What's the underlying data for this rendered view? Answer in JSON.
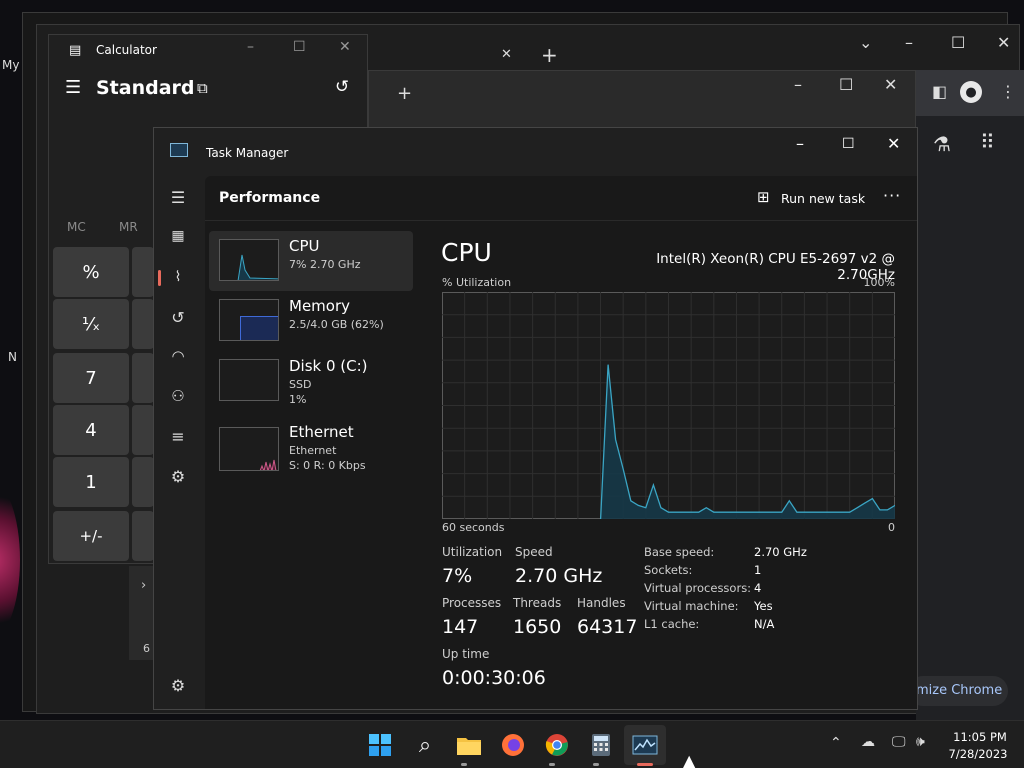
{
  "desktop": {
    "label_my": "My",
    "label_n": "N"
  },
  "chrome": {
    "customize_label": "mize Chrome",
    "new_tab_symbol": "+",
    "close_tab_symbol": "✕",
    "calc_partial_text": "6"
  },
  "calculator": {
    "title": "Calculator",
    "mode": "Standard",
    "memory": [
      "MC",
      "MR"
    ],
    "buttons": [
      "%",
      "¹⁄ₓ",
      "7",
      "4",
      "1",
      "+/-"
    ]
  },
  "taskmanager": {
    "title": "Task Manager",
    "section": "Performance",
    "run_new_task": "Run new task",
    "more": "···",
    "resources": [
      {
        "name": "CPU",
        "sub1": "7% 2.70 GHz",
        "sub2": ""
      },
      {
        "name": "Memory",
        "sub1": "2.5/4.0 GB (62%)",
        "sub2": ""
      },
      {
        "name": "Disk 0 (C:)",
        "sub1": "SSD",
        "sub2": "1%"
      },
      {
        "name": "Ethernet",
        "sub1": "Ethernet",
        "sub2": "S: 0 R: 0 Kbps"
      }
    ],
    "cpu": {
      "heading": "CPU",
      "model": "Intel(R) Xeon(R) CPU E5-2697 v2 @ 2.70GHz",
      "util_label": "% Utilization",
      "max_label": "100%",
      "time_label": "60 seconds",
      "zero_label": "0",
      "stats": {
        "utilization_label": "Utilization",
        "utilization": "7%",
        "speed_label": "Speed",
        "speed": "2.70 GHz",
        "processes_label": "Processes",
        "processes": "147",
        "threads_label": "Threads",
        "threads": "1650",
        "handles_label": "Handles",
        "handles": "64317",
        "uptime_label": "Up time",
        "uptime": "0:00:30:06"
      },
      "details": [
        {
          "k": "Base speed:",
          "v": "2.70 GHz"
        },
        {
          "k": "Sockets:",
          "v": "1"
        },
        {
          "k": "Virtual processors:",
          "v": "4"
        },
        {
          "k": "Virtual machine:",
          "v": "Yes"
        },
        {
          "k": "L1 cache:",
          "v": "N/A"
        }
      ]
    }
  },
  "chart_data": {
    "type": "area",
    "x": [
      60,
      59,
      58,
      57,
      56,
      55,
      54,
      53,
      52,
      51,
      50,
      49,
      48,
      47,
      46,
      45,
      44,
      43,
      42,
      41,
      40,
      39,
      38,
      37,
      36,
      35,
      34,
      33,
      32,
      31,
      30,
      29,
      28,
      27,
      26,
      25,
      24,
      23,
      22,
      21,
      20,
      19,
      18,
      17,
      16,
      15,
      14,
      13,
      12,
      11,
      10,
      9,
      8,
      7,
      6,
      5,
      4,
      3,
      2,
      1,
      0
    ],
    "series": [
      {
        "values": [
          0,
          0,
          0,
          0,
          0,
          0,
          0,
          0,
          0,
          0,
          0,
          0,
          0,
          0,
          0,
          0,
          0,
          0,
          0,
          0,
          0,
          0,
          68,
          35,
          22,
          8,
          6,
          5,
          15,
          5,
          3,
          3,
          3,
          3,
          3,
          5,
          3,
          3,
          3,
          3,
          3,
          3,
          3,
          3,
          3,
          3,
          8,
          3,
          3,
          3,
          3,
          3,
          3,
          3,
          3,
          5,
          7,
          9,
          4,
          4,
          6
        ]
      }
    ],
    "xlabel": "60 seconds",
    "ylabel": "% Utilization",
    "ylim": [
      0,
      100
    ],
    "grid": true,
    "color": "#3aa5c4"
  },
  "taskbar": {
    "time": "11:05 PM",
    "date": "7/28/2023",
    "icons": [
      "start-icon",
      "search-icon",
      "file-explorer-icon",
      "firefox-icon",
      "chrome-icon",
      "calculator-icon",
      "task-manager-icon"
    ]
  }
}
